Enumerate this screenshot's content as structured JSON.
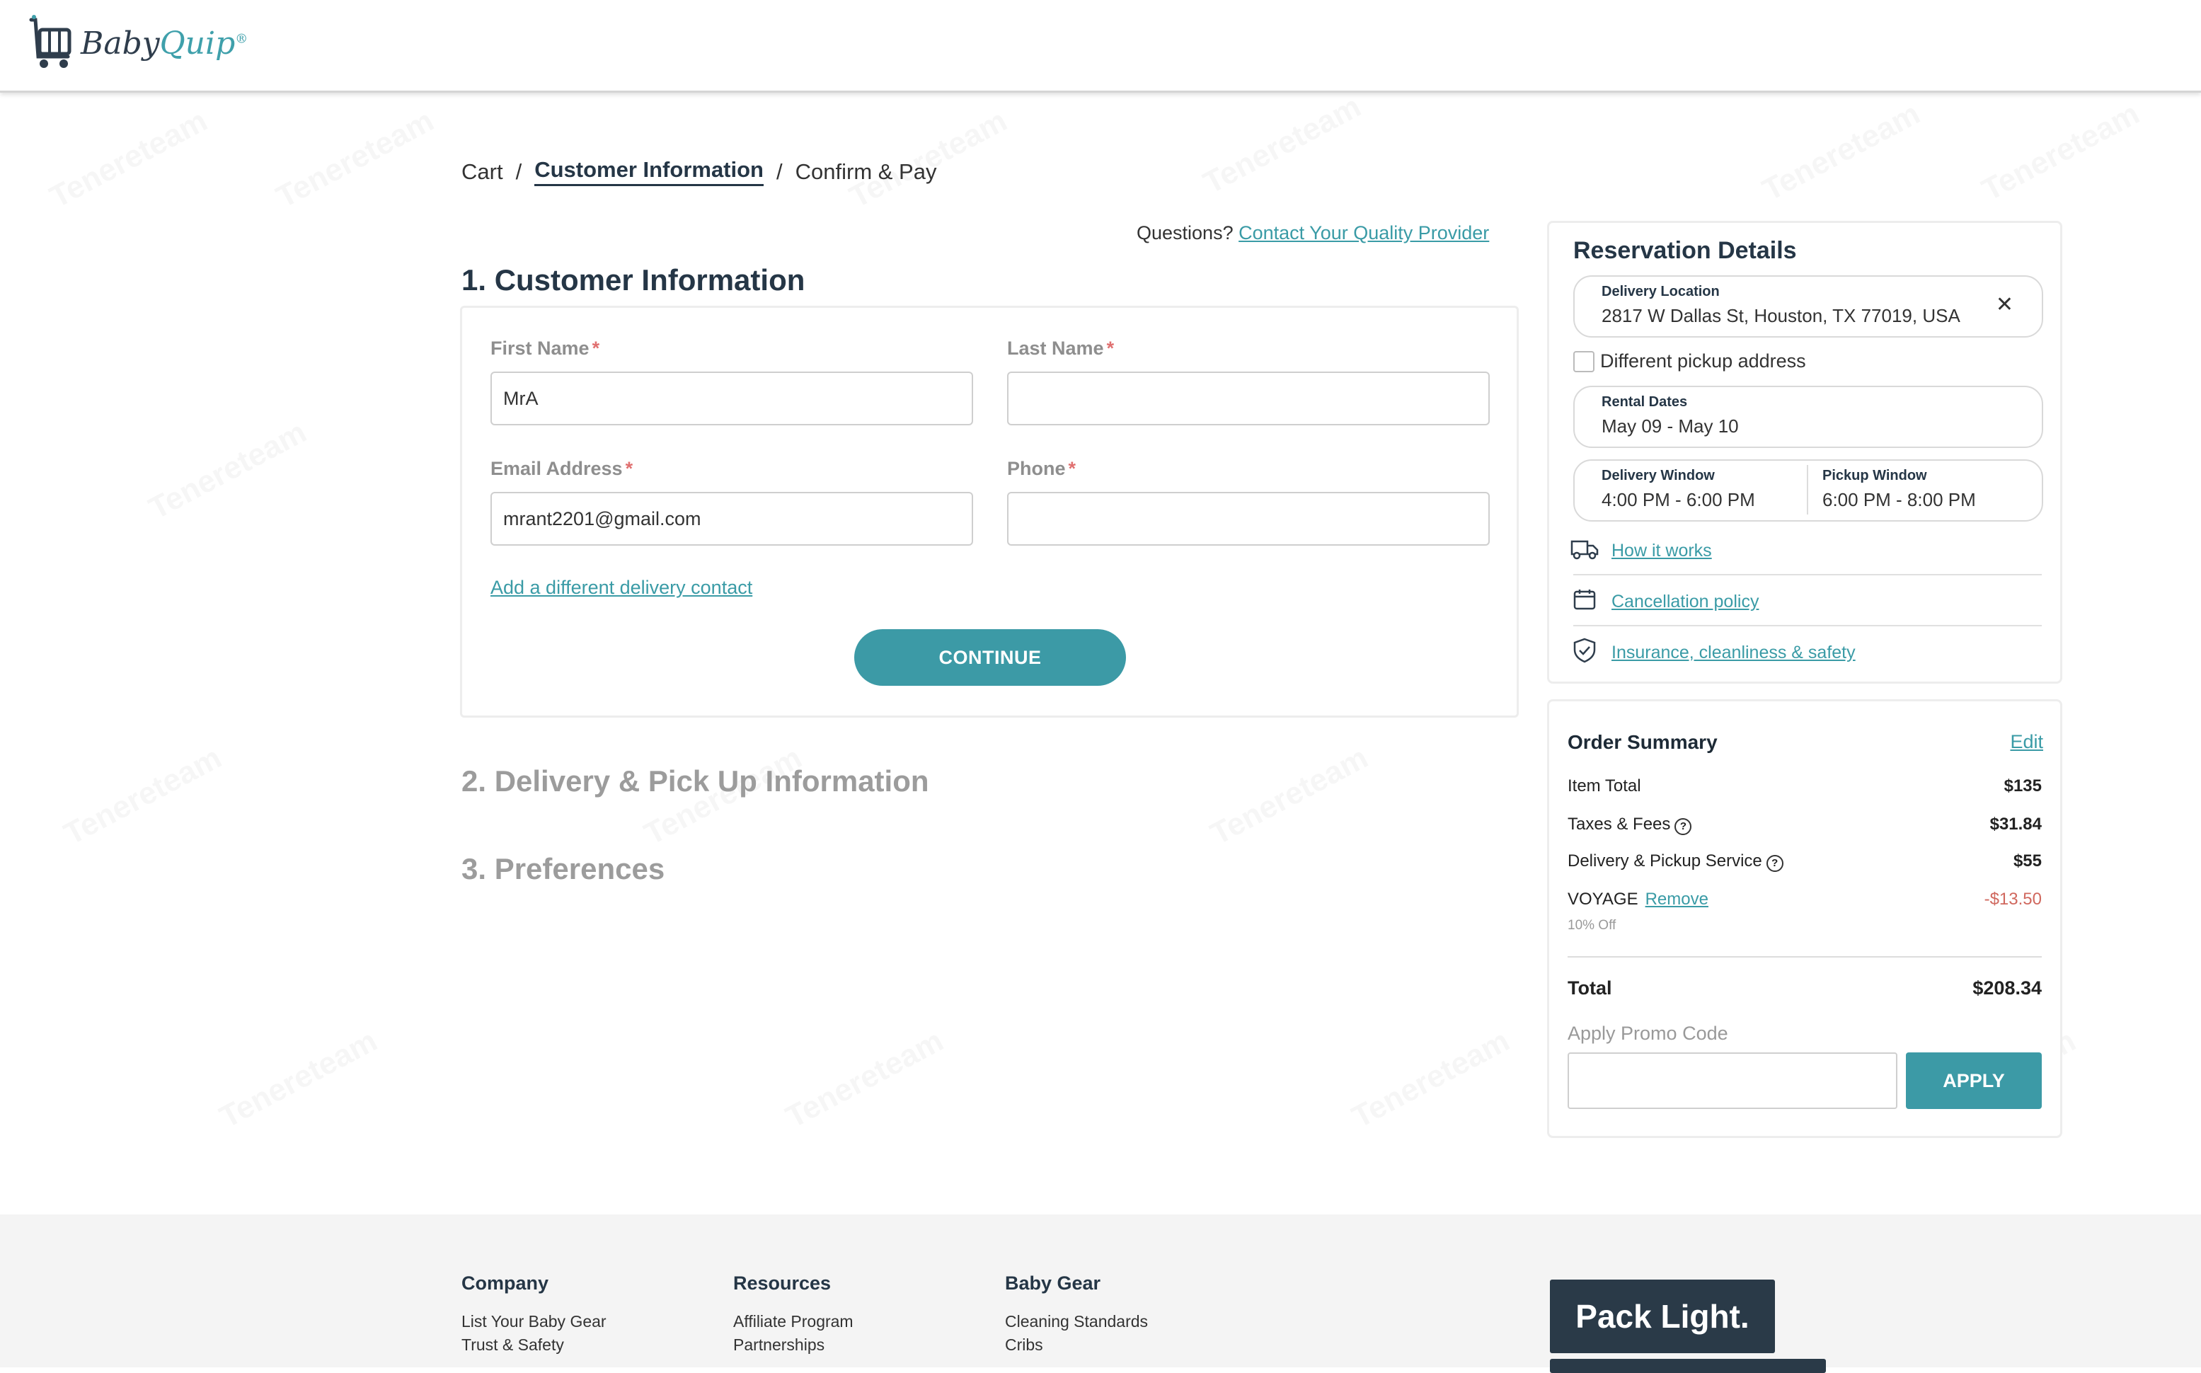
{
  "header": {
    "logo": {
      "part1": "Baby",
      "part2": "Quip",
      "mark": "®"
    }
  },
  "breadcrumb": {
    "items": [
      "Cart",
      "Customer Information",
      "Confirm & Pay"
    ],
    "separator": "/",
    "current_index": 1
  },
  "questions": {
    "prefix": "Questions?",
    "link": "Contact Your Quality Provider"
  },
  "sections": {
    "customer": "1. Customer Information",
    "delivery": "2. Delivery & Pick Up Information",
    "preferences": "3. Preferences"
  },
  "form": {
    "first_name": {
      "label": "First Name",
      "required": "*",
      "value": "MrA"
    },
    "last_name": {
      "label": "Last Name",
      "required": "*",
      "value": ""
    },
    "email": {
      "label": "Email Address",
      "required": "*",
      "value": "mrant2201@gmail.com"
    },
    "phone": {
      "label": "Phone",
      "required": "*",
      "value": ""
    },
    "add_contact": "Add a different delivery contact",
    "continue": "CONTINUE"
  },
  "reservation": {
    "title": "Reservation Details",
    "delivery_location": {
      "label": "Delivery Location",
      "value": "2817 W Dallas St, Houston, TX 77019, USA"
    },
    "different_pickup": "Different pickup address",
    "rental_dates": {
      "label": "Rental Dates",
      "value": "May 09 - May 10"
    },
    "delivery_window": {
      "label": "Delivery Window",
      "value": "4:00 PM - 6:00 PM"
    },
    "pickup_window": {
      "label": "Pickup Window",
      "value": "6:00 PM - 8:00 PM"
    },
    "links": [
      "How it works",
      "Cancellation policy",
      "Insurance, cleanliness & safety"
    ]
  },
  "order_summary": {
    "title": "Order Summary",
    "edit": "Edit",
    "item_total": {
      "label": "Item Total",
      "value": "$135"
    },
    "taxes": {
      "label": "Taxes & Fees",
      "value": "$31.84"
    },
    "delivery": {
      "label": "Delivery & Pickup Service",
      "value": "$55"
    },
    "promo": {
      "code": "VOYAGE",
      "remove": "Remove",
      "value": "-$13.50",
      "note": "10% Off"
    },
    "total": {
      "label": "Total",
      "value": "$208.34"
    },
    "promo_label": "Apply Promo Code",
    "promo_placeholder": "",
    "apply": "APPLY"
  },
  "footer": {
    "company": {
      "title": "Company",
      "items": [
        "List Your Baby Gear",
        "Trust & Safety"
      ]
    },
    "resources": {
      "title": "Resources",
      "items": [
        "Affiliate Program",
        "Partnerships"
      ]
    },
    "baby_gear": {
      "title": "Baby Gear",
      "items": [
        "Cleaning Standards",
        "Cribs"
      ]
    },
    "promo_banner": "Pack Light."
  },
  "watermark": "Tenereteam",
  "colors": {
    "accent": "#3c9aa6",
    "navy": "#253646",
    "negative": "#d0685e"
  }
}
